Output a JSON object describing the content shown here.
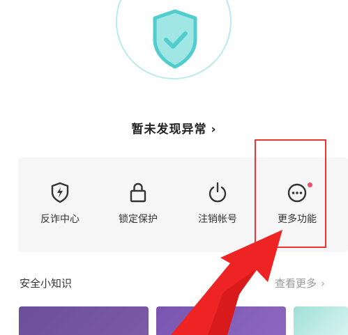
{
  "status": {
    "text": "暂未发现异常",
    "chevron": "›",
    "icon": "shield-check-icon"
  },
  "functions": [
    {
      "label": "反诈中心",
      "icon": "shield-lightning-icon"
    },
    {
      "label": "锁定保护",
      "icon": "lock-icon"
    },
    {
      "label": "注销帐号",
      "icon": "power-icon"
    },
    {
      "label": "更多功能",
      "icon": "more-dots-icon",
      "badge": "red-dot"
    }
  ],
  "knowledge": {
    "title": "安全小知识",
    "see_more": "查看更多",
    "chevron": "›"
  },
  "colors": {
    "accent": "#52cdcd",
    "badge": "#f0506a",
    "annotation": "#e33333"
  }
}
